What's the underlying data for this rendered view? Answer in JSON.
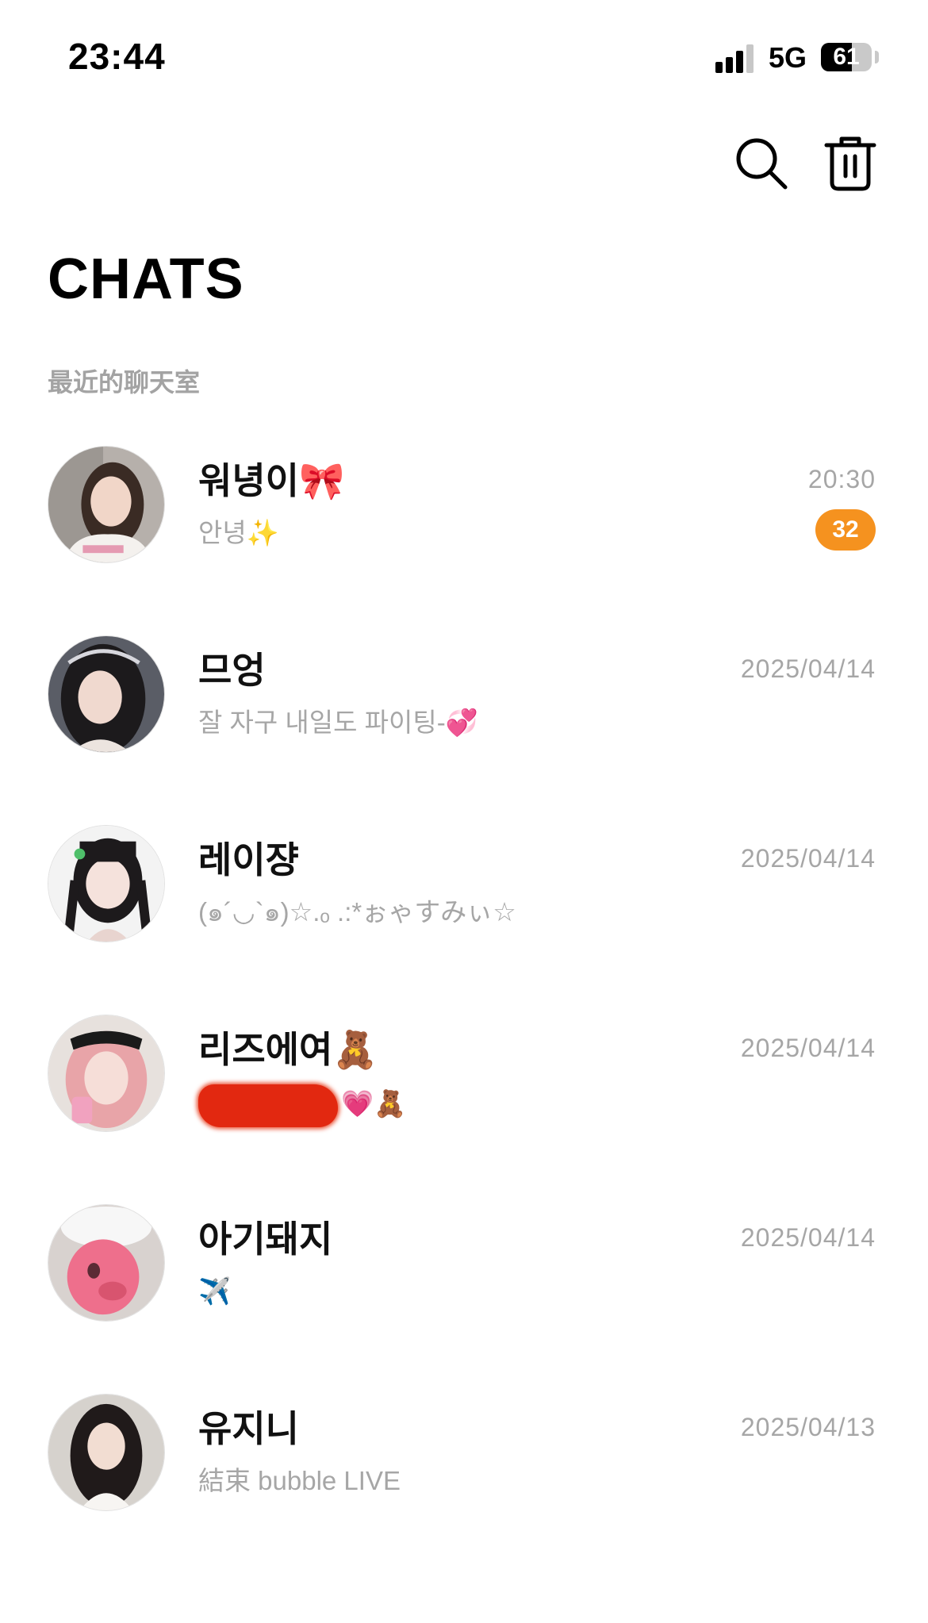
{
  "status_bar": {
    "time": "23:44",
    "network": "5G",
    "battery": "61",
    "battery_level": 0.61
  },
  "header": {
    "title": "CHATS",
    "search_icon": "search-icon",
    "trash_icon": "trash-icon"
  },
  "section_label": "最近的聊天室",
  "colors": {
    "accent": "#f5921f",
    "muted_text": "#a6a6a6",
    "redaction": "#e22810"
  },
  "chats": [
    {
      "name": "워녕이🎀",
      "preview": "안녕✨",
      "time": "20:30",
      "unread": "32"
    },
    {
      "name": "므엉",
      "preview": "잘 자구 내일도 파이팅-💞",
      "time": "2025/04/14"
    },
    {
      "name": "레이쟝",
      "preview": "(๑´◡`๑)☆.ₒ .:*ぉゃすみぃ☆",
      "time": "2025/04/14"
    },
    {
      "name": "리즈에여🧸",
      "preview": "💗🧸",
      "time": "2025/04/14",
      "redacted": true
    },
    {
      "name": "아기돼지",
      "preview": "✈️",
      "time": "2025/04/14"
    },
    {
      "name": "유지니",
      "preview": "結束 bubble LIVE",
      "time": "2025/04/13"
    }
  ]
}
